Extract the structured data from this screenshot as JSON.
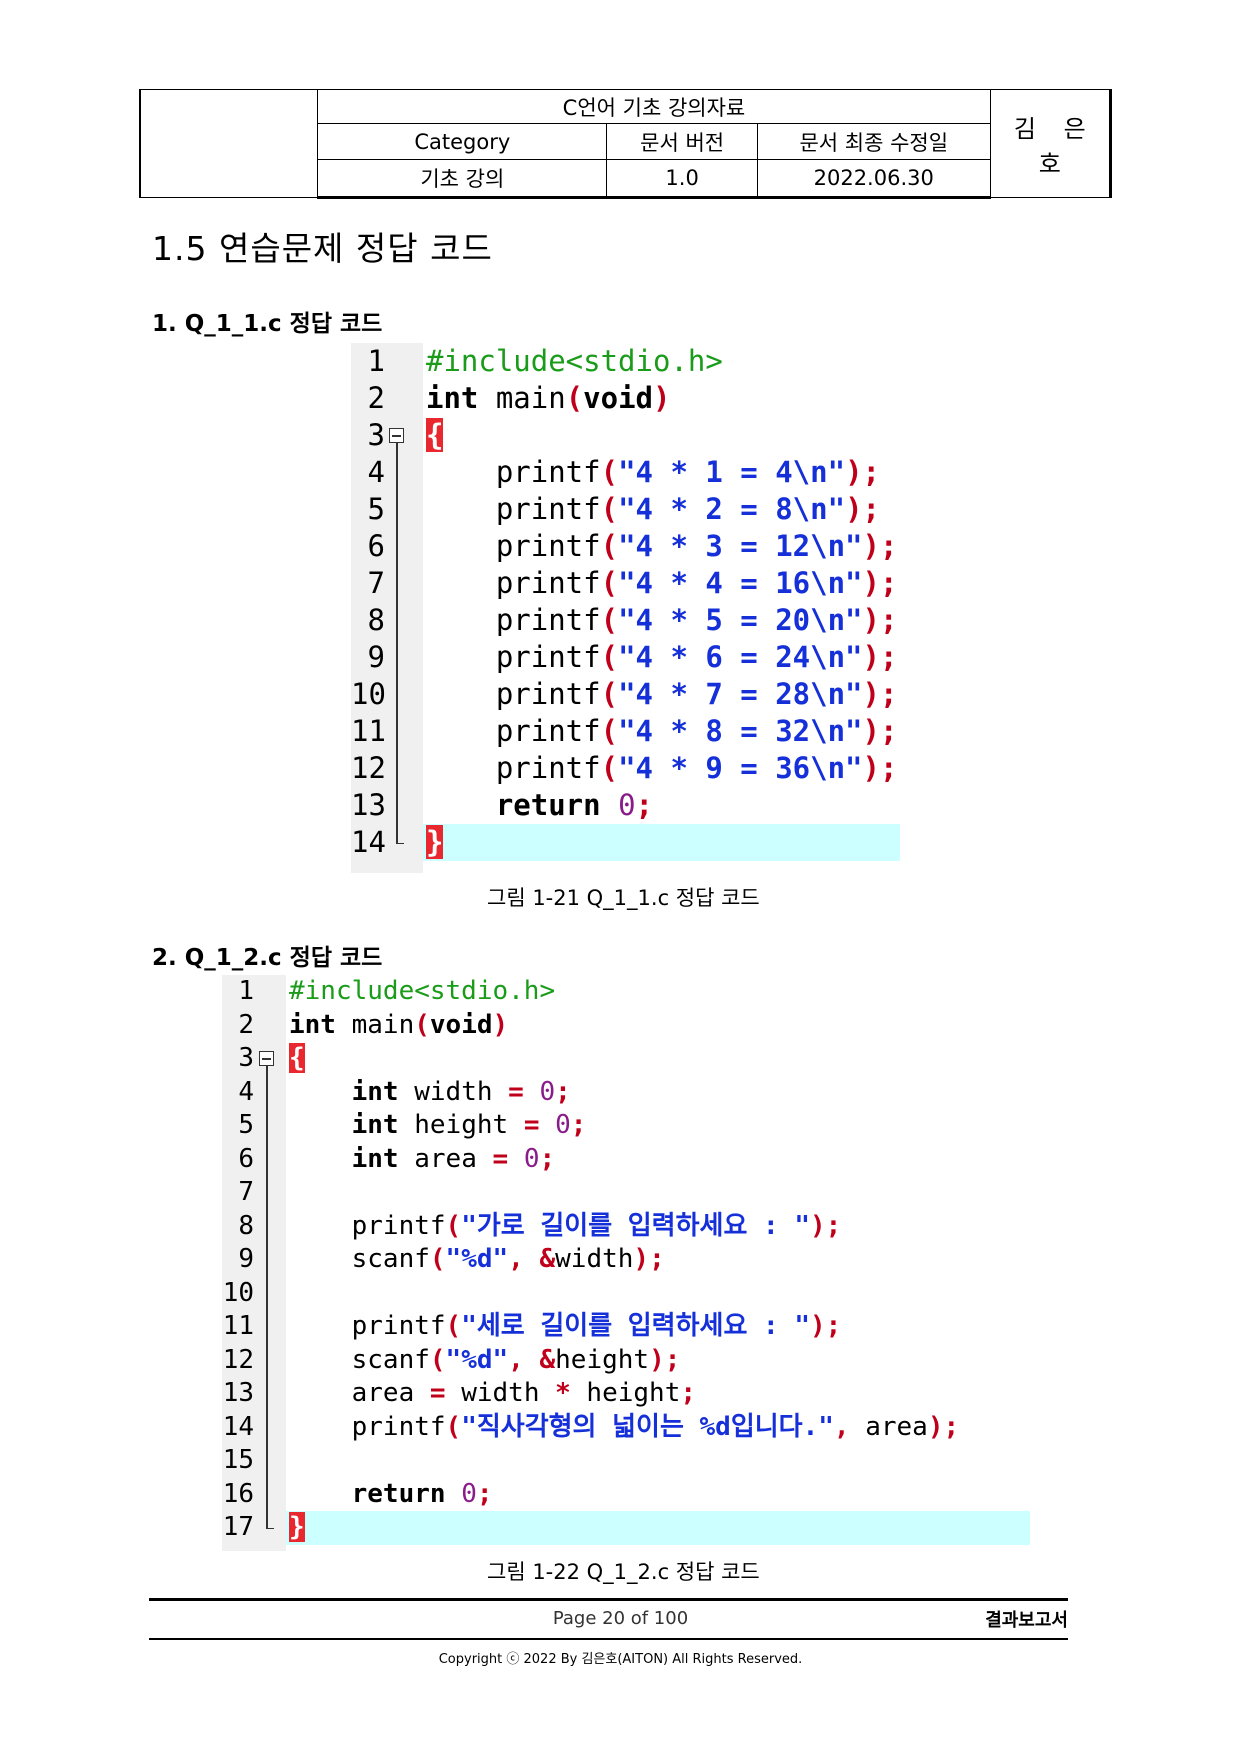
{
  "header": {
    "title": "C언어 기초 강의자료",
    "col_category": "Category",
    "col_version": "문서 버전",
    "col_modified": "문서 최종 수정일",
    "category": "기초 강의",
    "version": "1.0",
    "modified": "2022.06.30",
    "author": "김 은 호"
  },
  "section_title": "1.5  연습문제 정답 코드",
  "subsections": [
    {
      "title": "1. Q_1_1.c 정답 코드",
      "caption": "그림 1-21 Q_1_1.c 정답 코드",
      "line_numbers": [
        "1",
        "2",
        "3",
        "4",
        "5",
        "6",
        "7",
        "8",
        "9",
        "10",
        "11",
        "12",
        "13",
        "14"
      ],
      "lines": [
        [
          {
            "t": "#include<stdio.h>",
            "c": "pp"
          }
        ],
        [
          {
            "t": "int",
            "c": "kw"
          },
          {
            "t": " main",
            "c": "id"
          },
          {
            "t": "(",
            "c": "sym"
          },
          {
            "t": "void",
            "c": "kw"
          },
          {
            "t": ")",
            "c": "sym"
          }
        ],
        [
          {
            "t": "{",
            "c": "brace"
          }
        ],
        [
          {
            "t": "    printf",
            "c": "id"
          },
          {
            "t": "(",
            "c": "sym"
          },
          {
            "t": "\"4 * 1 = 4\\n\"",
            "c": "str"
          },
          {
            "t": ");",
            "c": "sym"
          }
        ],
        [
          {
            "t": "    printf",
            "c": "id"
          },
          {
            "t": "(",
            "c": "sym"
          },
          {
            "t": "\"4 * 2 = 8\\n\"",
            "c": "str"
          },
          {
            "t": ");",
            "c": "sym"
          }
        ],
        [
          {
            "t": "    printf",
            "c": "id"
          },
          {
            "t": "(",
            "c": "sym"
          },
          {
            "t": "\"4 * 3 = 12\\n\"",
            "c": "str"
          },
          {
            "t": ");",
            "c": "sym"
          }
        ],
        [
          {
            "t": "    printf",
            "c": "id"
          },
          {
            "t": "(",
            "c": "sym"
          },
          {
            "t": "\"4 * 4 = 16\\n\"",
            "c": "str"
          },
          {
            "t": ");",
            "c": "sym"
          }
        ],
        [
          {
            "t": "    printf",
            "c": "id"
          },
          {
            "t": "(",
            "c": "sym"
          },
          {
            "t": "\"4 * 5 = 20\\n\"",
            "c": "str"
          },
          {
            "t": ");",
            "c": "sym"
          }
        ],
        [
          {
            "t": "    printf",
            "c": "id"
          },
          {
            "t": "(",
            "c": "sym"
          },
          {
            "t": "\"4 * 6 = 24\\n\"",
            "c": "str"
          },
          {
            "t": ");",
            "c": "sym"
          }
        ],
        [
          {
            "t": "    printf",
            "c": "id"
          },
          {
            "t": "(",
            "c": "sym"
          },
          {
            "t": "\"4 * 7 = 28\\n\"",
            "c": "str"
          },
          {
            "t": ");",
            "c": "sym"
          }
        ],
        [
          {
            "t": "    printf",
            "c": "id"
          },
          {
            "t": "(",
            "c": "sym"
          },
          {
            "t": "\"4 * 8 = 32\\n\"",
            "c": "str"
          },
          {
            "t": ");",
            "c": "sym"
          }
        ],
        [
          {
            "t": "    printf",
            "c": "id"
          },
          {
            "t": "(",
            "c": "sym"
          },
          {
            "t": "\"4 * 9 = 36\\n\"",
            "c": "str"
          },
          {
            "t": ");",
            "c": "sym"
          }
        ],
        [
          {
            "t": "    return",
            "c": "kw"
          },
          {
            "t": " ",
            "c": "id"
          },
          {
            "t": "0",
            "c": "num"
          },
          {
            "t": ";",
            "c": "sym"
          }
        ],
        [
          {
            "t": "}",
            "c": "brace"
          }
        ]
      ]
    },
    {
      "title": "2. Q_1_2.c 정답 코드",
      "caption": "그림 1-22 Q_1_2.c 정답 코드",
      "line_numbers": [
        "1",
        "2",
        "3",
        "4",
        "5",
        "6",
        "7",
        "8",
        "9",
        "10",
        "11",
        "12",
        "13",
        "14",
        "15",
        "16",
        "17"
      ],
      "lines": [
        [
          {
            "t": "#include<stdio.h>",
            "c": "pp"
          }
        ],
        [
          {
            "t": "int",
            "c": "kw"
          },
          {
            "t": " main",
            "c": "id"
          },
          {
            "t": "(",
            "c": "sym"
          },
          {
            "t": "void",
            "c": "kw"
          },
          {
            "t": ")",
            "c": "sym"
          }
        ],
        [
          {
            "t": "{",
            "c": "brace"
          }
        ],
        [
          {
            "t": "    ",
            "c": "id"
          },
          {
            "t": "int",
            "c": "kw"
          },
          {
            "t": " width ",
            "c": "id"
          },
          {
            "t": "=",
            "c": "sym"
          },
          {
            "t": " ",
            "c": "id"
          },
          {
            "t": "0",
            "c": "num"
          },
          {
            "t": ";",
            "c": "sym"
          }
        ],
        [
          {
            "t": "    ",
            "c": "id"
          },
          {
            "t": "int",
            "c": "kw"
          },
          {
            "t": " height ",
            "c": "id"
          },
          {
            "t": "=",
            "c": "sym"
          },
          {
            "t": " ",
            "c": "id"
          },
          {
            "t": "0",
            "c": "num"
          },
          {
            "t": ";",
            "c": "sym"
          }
        ],
        [
          {
            "t": "    ",
            "c": "id"
          },
          {
            "t": "int",
            "c": "kw"
          },
          {
            "t": " area ",
            "c": "id"
          },
          {
            "t": "=",
            "c": "sym"
          },
          {
            "t": " ",
            "c": "id"
          },
          {
            "t": "0",
            "c": "num"
          },
          {
            "t": ";",
            "c": "sym"
          }
        ],
        [],
        [
          {
            "t": "    printf",
            "c": "id"
          },
          {
            "t": "(",
            "c": "sym"
          },
          {
            "t": "\"가로 길이를 입력하세요 : \"",
            "c": "str"
          },
          {
            "t": ");",
            "c": "sym"
          }
        ],
        [
          {
            "t": "    scanf",
            "c": "id"
          },
          {
            "t": "(",
            "c": "sym"
          },
          {
            "t": "\"%d\"",
            "c": "str"
          },
          {
            "t": ", &",
            "c": "sym"
          },
          {
            "t": "width",
            "c": "id"
          },
          {
            "t": ");",
            "c": "sym"
          }
        ],
        [],
        [
          {
            "t": "    printf",
            "c": "id"
          },
          {
            "t": "(",
            "c": "sym"
          },
          {
            "t": "\"세로 길이를 입력하세요 : \"",
            "c": "str"
          },
          {
            "t": ");",
            "c": "sym"
          }
        ],
        [
          {
            "t": "    scanf",
            "c": "id"
          },
          {
            "t": "(",
            "c": "sym"
          },
          {
            "t": "\"%d\"",
            "c": "str"
          },
          {
            "t": ", &",
            "c": "sym"
          },
          {
            "t": "height",
            "c": "id"
          },
          {
            "t": ");",
            "c": "sym"
          }
        ],
        [
          {
            "t": "    area ",
            "c": "id"
          },
          {
            "t": "=",
            "c": "sym"
          },
          {
            "t": " width ",
            "c": "id"
          },
          {
            "t": "*",
            "c": "sym"
          },
          {
            "t": " height",
            "c": "id"
          },
          {
            "t": ";",
            "c": "sym"
          }
        ],
        [
          {
            "t": "    printf",
            "c": "id"
          },
          {
            "t": "(",
            "c": "sym"
          },
          {
            "t": "\"직사각형의 넓이는 %d입니다.\"",
            "c": "str"
          },
          {
            "t": ",",
            "c": "sym"
          },
          {
            "t": " area",
            "c": "id"
          },
          {
            "t": ");",
            "c": "sym"
          }
        ],
        [],
        [
          {
            "t": "    return",
            "c": "kw"
          },
          {
            "t": " ",
            "c": "id"
          },
          {
            "t": "0",
            "c": "num"
          },
          {
            "t": ";",
            "c": "sym"
          }
        ],
        [
          {
            "t": "}",
            "c": "brace"
          }
        ]
      ]
    }
  ],
  "footer": {
    "page": "Page 20 of 100",
    "report": "결과보고서",
    "copyright": "Copyright ⓒ 2022 By 김은호(AITON) All Rights Reserved."
  }
}
